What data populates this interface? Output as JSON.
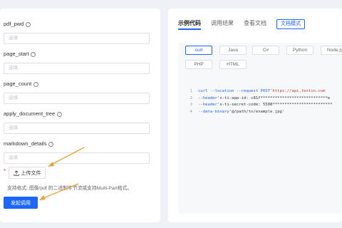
{
  "form": {
    "fields": [
      {
        "label": "pdf_pwd",
        "placeholder": "选填"
      },
      {
        "label": "page_start",
        "placeholder": "选填"
      },
      {
        "label": "page_count",
        "placeholder": "选填"
      },
      {
        "label": "apply_document_tree",
        "placeholder": "选填"
      },
      {
        "label": "markdown_details",
        "placeholder": "选填"
      }
    ],
    "required_star": "*",
    "upload_label": "上传文件",
    "support_text": "支持格式: 图像/pdf 的二进制字节流或支持Multi-Part格式。",
    "submit_label": "发起调用"
  },
  "tabs": {
    "items": [
      "示例代码",
      "调用结果",
      "查看文档"
    ],
    "outline_tab": "文档模式"
  },
  "languages": [
    "curl",
    "Java",
    "C#",
    "Python",
    "Node.js",
    "PHP",
    "HTML"
  ],
  "code_lines": [
    {
      "n": "1",
      "a": "curl --location --request POST ",
      "b": "'https://api.textin.com"
    },
    {
      "n": "2",
      "a": "--header ",
      "b": "'x-ti-app-id: c81f****************************e"
    },
    {
      "n": "3",
      "a": "--header ",
      "b": "'x-ti-secret-code: 5508*************************"
    },
    {
      "n": "4",
      "a": "--data-binary ",
      "b": "'@/path/to/example.jpg'"
    }
  ],
  "colors": {
    "accent": "#1a66ff",
    "arrow": "#e8a33c",
    "background": "#eef1f6"
  }
}
